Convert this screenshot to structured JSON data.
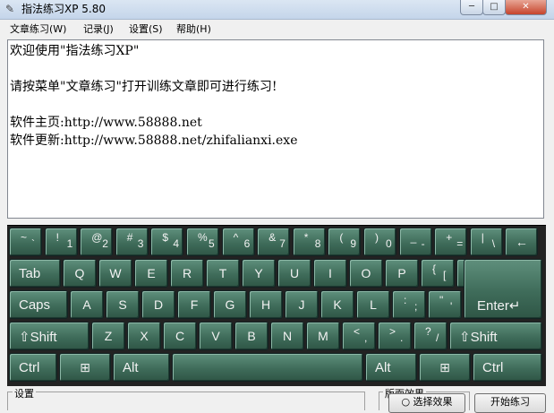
{
  "window": {
    "title": "指法练习XP 5.80",
    "app_icon": "✎",
    "min_glyph": "─",
    "max_glyph": "□",
    "close_glyph": "✕"
  },
  "menu": [
    "文章练习(W)",
    "记录(J)",
    "设置(S)",
    "帮助(H)"
  ],
  "text_lines": [
    "欢迎使用\"指法练习XP\"",
    "",
    "请按菜单\"文章练习\"打开训练文章即可进行练习!",
    "",
    "软件主页:http://www.58888.net",
    "软件更新:http://www.58888.net/zhifalianxi.exe"
  ],
  "keyboard": {
    "row1": [
      {
        "s": "~",
        "d": "`"
      },
      {
        "s": "!",
        "d": "1"
      },
      {
        "s": "@",
        "d": "2"
      },
      {
        "s": "#",
        "d": "3"
      },
      {
        "s": "$",
        "d": "4"
      },
      {
        "s": "%",
        "d": "5"
      },
      {
        "s": "^",
        "d": "6"
      },
      {
        "s": "&",
        "d": "7"
      },
      {
        "s": "*",
        "d": "8"
      },
      {
        "s": "(",
        "d": "9"
      },
      {
        "s": ")",
        "d": "0"
      },
      {
        "s": "_",
        "d": "-"
      },
      {
        "s": "+",
        "d": "="
      },
      {
        "s": "|",
        "d": "\\"
      },
      {
        "c": "←"
      }
    ],
    "row2": [
      "Tab",
      "Q",
      "W",
      "E",
      "R",
      "T",
      "Y",
      "U",
      "I",
      "O",
      "P"
    ],
    "row2_brackets": [
      {
        "s": "{",
        "d": "["
      },
      {
        "s": "}",
        "d": "]"
      }
    ],
    "row3": [
      "Caps",
      "A",
      "S",
      "D",
      "F",
      "G",
      "H",
      "J",
      "K",
      "L"
    ],
    "row3_punct": [
      {
        "s": ":",
        "d": ";"
      },
      {
        "s": "\"",
        "d": "'"
      }
    ],
    "enter": "Enter↵",
    "row4_lshift": "⇧Shift",
    "row4": [
      "Z",
      "X",
      "C",
      "V",
      "B",
      "N",
      "M"
    ],
    "row4_punct": [
      {
        "s": "<",
        "d": ","
      },
      {
        "s": ">",
        "d": "."
      },
      {
        "s": "?",
        "d": "/"
      }
    ],
    "row4_rshift": "⇧Shift",
    "row5": {
      "ctrl": "Ctrl",
      "win": "⊞",
      "alt": "Alt",
      "alt2": "Alt",
      "win2": "⊞",
      "ctrl2": "Ctrl"
    }
  },
  "bottom": {
    "settings_label": "设置",
    "effect_label": "版面效果",
    "effect_btn": "○ 选择效果",
    "start_btn": "开始练习"
  }
}
